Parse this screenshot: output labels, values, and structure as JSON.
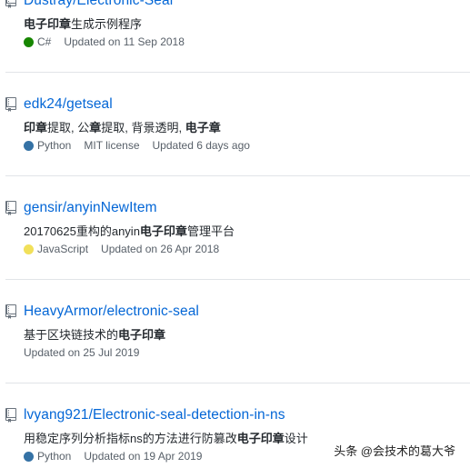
{
  "repos": [
    {
      "title": "Dustray/Electronic-Seal",
      "desc_parts": [
        {
          "text": "电子印章",
          "bold": true
        },
        {
          "text": "生成示例程序",
          "bold": false
        }
      ],
      "language": "C#",
      "language_color": "#178600",
      "license": "",
      "updated": "Updated on 11 Sep 2018"
    },
    {
      "title": "edk24/getseal",
      "desc_parts": [
        {
          "text": "印章",
          "bold": true
        },
        {
          "text": "提取, 公",
          "bold": false
        },
        {
          "text": "章",
          "bold": true
        },
        {
          "text": "提取, 背景透明, ",
          "bold": false
        },
        {
          "text": "电子章",
          "bold": true
        }
      ],
      "language": "Python",
      "language_color": "#3572A5",
      "license": "MIT license",
      "updated": "Updated 6 days ago"
    },
    {
      "title": "gensir/anyinNewItem",
      "desc_parts": [
        {
          "text": "20170625重构的anyin",
          "bold": false
        },
        {
          "text": "电子印章",
          "bold": true
        },
        {
          "text": "管理平台",
          "bold": false
        }
      ],
      "language": "JavaScript",
      "language_color": "#f1e05a",
      "license": "",
      "updated": "Updated on 26 Apr 2018"
    },
    {
      "title": "HeavyArmor/electronic-seal",
      "desc_parts": [
        {
          "text": "基于区块链技术的",
          "bold": false
        },
        {
          "text": "电子印章",
          "bold": true
        }
      ],
      "language": "",
      "language_color": "",
      "license": "",
      "updated": "Updated on 25 Jul 2019"
    },
    {
      "title": "lvyang921/Electronic-seal-detection-in-ns",
      "desc_parts": [
        {
          "text": "用稳定序列分析指标ns的方法进行防篡改",
          "bold": false
        },
        {
          "text": "电子印章",
          "bold": true
        },
        {
          "text": "设计",
          "bold": false
        }
      ],
      "language": "Python",
      "language_color": "#3572A5",
      "license": "",
      "updated": "Updated on 19 Apr 2019"
    }
  ],
  "watermark": "头条 @会技术的葛大爷",
  "icons": {
    "repo": "repo-icon"
  }
}
